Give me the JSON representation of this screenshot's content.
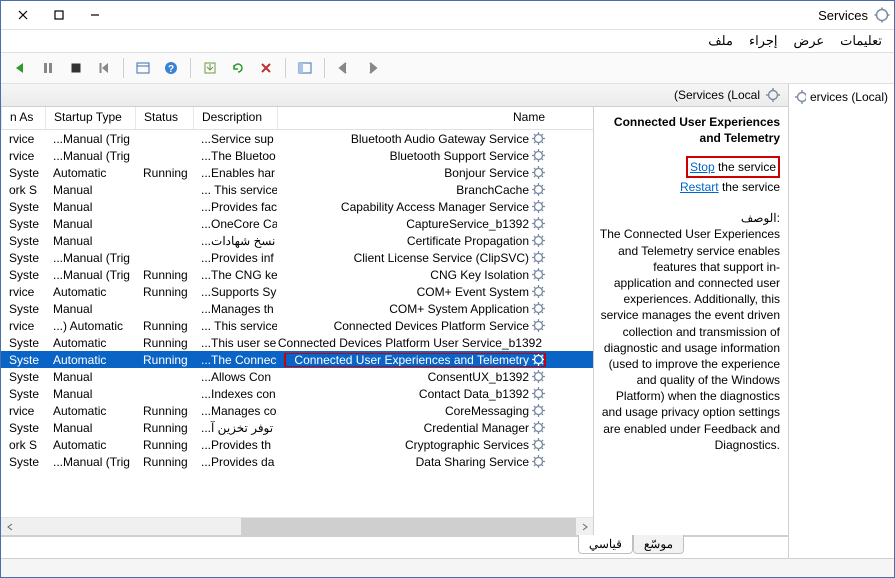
{
  "window": {
    "title": "Services"
  },
  "menu": {
    "file": "ملف",
    "action": "إجراء",
    "view": "عرض",
    "help": "تعليمات"
  },
  "tree": {
    "root": "ervices (Local)"
  },
  "mainHeader": "(Services (Local",
  "detail": {
    "title": "Connected User Experiences and Telemetry",
    "stop_link": "Stop",
    "stop_rest": " the service",
    "restart_link": "Restart",
    "restart_rest": " the service",
    "desc_label": "الوصف:",
    "desc_body": "The Connected User Experiences and Telemetry service enables features that support in-application and connected user experiences. Additionally, this service manages the event driven collection and transmission of diagnostic and usage information (used to improve the experience and quality of the Windows Platform) when the diagnostics and usage privacy option settings are enabled under Feedback and Diagnostics."
  },
  "columns": {
    "name": "Name",
    "desc": "Description",
    "status": "Status",
    "startup": "Startup Type",
    "logon": "n As"
  },
  "tabs": {
    "extended": "موسّع",
    "standard": "قياسي"
  },
  "services": [
    {
      "name": "Bluetooth Audio Gateway Service",
      "desc": "...Service sup",
      "status": "",
      "startup": "...Manual (Trig",
      "logon": "rvice"
    },
    {
      "name": "Bluetooth Support Service",
      "desc": "...The Bluetoo",
      "status": "",
      "startup": "...Manual (Trig",
      "logon": "rvice"
    },
    {
      "name": "Bonjour Service",
      "desc": "...Enables har",
      "status": "Running",
      "startup": "Automatic",
      "logon": "Syste"
    },
    {
      "name": "BranchCache",
      "desc": "... This service",
      "status": "",
      "startup": "Manual",
      "logon": "ork S"
    },
    {
      "name": "Capability Access Manager Service",
      "desc": "...Provides fac",
      "status": "",
      "startup": "Manual",
      "logon": "Syste"
    },
    {
      "name": "CaptureService_b1392",
      "desc": "...OneCore Ca",
      "status": "",
      "startup": "Manual",
      "logon": "Syste"
    },
    {
      "name": "Certificate Propagation",
      "desc": "...نسخ شهادات",
      "status": "",
      "startup": "Manual",
      "logon": "Syste"
    },
    {
      "name": "Client License Service (ClipSVC)",
      "desc": "...Provides inf",
      "status": "",
      "startup": "...Manual (Trig",
      "logon": "Syste"
    },
    {
      "name": "CNG Key Isolation",
      "desc": "...The CNG ke",
      "status": "Running",
      "startup": "...Manual (Trig",
      "logon": "Syste"
    },
    {
      "name": "COM+ Event System",
      "desc": "...Supports Sy",
      "status": "Running",
      "startup": "Automatic",
      "logon": "rvice"
    },
    {
      "name": "COM+ System Application",
      "desc": "...Manages th",
      "status": "",
      "startup": "Manual",
      "logon": "Syste"
    },
    {
      "name": "Connected Devices Platform Service",
      "desc": "... This service",
      "status": "Running",
      "startup": "...) Automatic",
      "logon": "rvice"
    },
    {
      "name": "Connected Devices Platform User Service_b1392",
      "desc": "...This user se",
      "status": "Running",
      "startup": "Automatic",
      "logon": "Syste"
    },
    {
      "name": "Connected User Experiences and Telemetry",
      "desc": "...The Connec",
      "status": "Running",
      "startup": "Automatic",
      "logon": "Syste",
      "selected": true,
      "boxed": true
    },
    {
      "name": "ConsentUX_b1392",
      "desc": "...Allows Con",
      "status": "",
      "startup": "Manual",
      "logon": "Syste"
    },
    {
      "name": "Contact Data_b1392",
      "desc": "...Indexes con",
      "status": "",
      "startup": "Manual",
      "logon": "Syste"
    },
    {
      "name": "CoreMessaging",
      "desc": "...Manages co",
      "status": "Running",
      "startup": "Automatic",
      "logon": "rvice"
    },
    {
      "name": "Credential Manager",
      "desc": "...توفر تخزين آ",
      "status": "Running",
      "startup": "Manual",
      "logon": "Syste"
    },
    {
      "name": "Cryptographic Services",
      "desc": "...Provides th",
      "status": "Running",
      "startup": "Automatic",
      "logon": "ork S"
    },
    {
      "name": "Data Sharing Service",
      "desc": "...Provides da",
      "status": "Running",
      "startup": "...Manual (Trig",
      "logon": "Syste"
    }
  ]
}
